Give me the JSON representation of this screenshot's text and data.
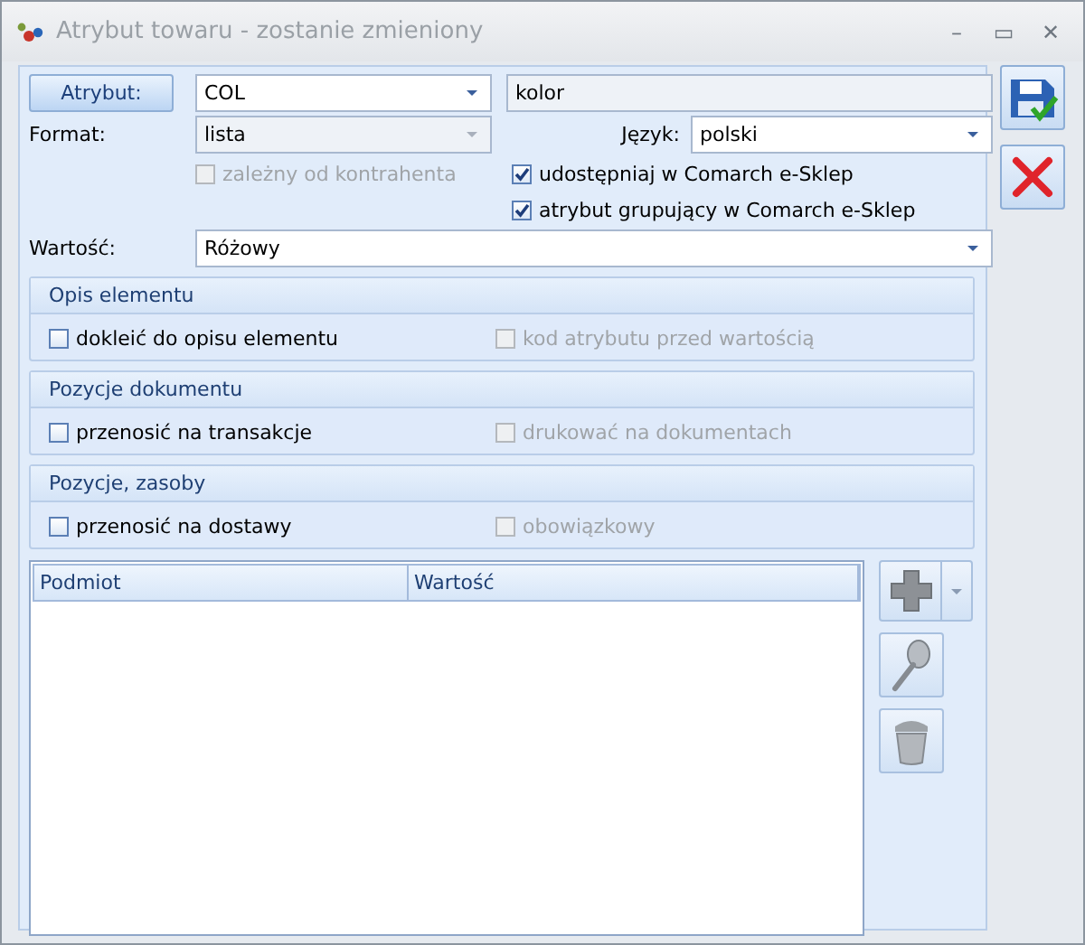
{
  "window": {
    "title": "Atrybut towaru - zostanie zmieniony",
    "controls": [
      "–",
      "▭",
      "✕"
    ]
  },
  "attribute": {
    "button": "Atrybut:",
    "code": "COL",
    "name": "kolor"
  },
  "format": {
    "label": "Format:",
    "value": "lista",
    "disabled": true
  },
  "language": {
    "label": "Język:",
    "value": "polski",
    "disabled": false
  },
  "options": [
    {
      "label": "zależny od kontrahenta",
      "checked": false,
      "disabled": true
    },
    {
      "label": "udostępniaj w Comarch e-Sklep",
      "checked": true,
      "disabled": false
    },
    {
      "label": "atrybut grupujący w Comarch e-Sklep",
      "checked": true,
      "disabled": false
    }
  ],
  "value": {
    "label": "Wartość:",
    "value": "Różowy"
  },
  "groups": [
    {
      "title": "Opis elementu",
      "options": [
        {
          "label": "dokleić do opisu elementu",
          "checked": false,
          "disabled": false
        },
        {
          "label": "kod atrybutu przed wartością",
          "checked": false,
          "disabled": true
        }
      ]
    },
    {
      "title": "Pozycje dokumentu",
      "options": [
        {
          "label": "przenosić na transakcje",
          "checked": false,
          "disabled": false
        },
        {
          "label": "drukować na dokumentach",
          "checked": false,
          "disabled": true
        }
      ]
    },
    {
      "title": "Pozycje, zasoby",
      "options": [
        {
          "label": "przenosić na dostawy",
          "checked": false,
          "disabled": false
        },
        {
          "label": "obowiązkowy",
          "checked": false,
          "disabled": true
        }
      ]
    }
  ],
  "table": {
    "columns": [
      "Podmiot",
      "Wartość"
    ]
  }
}
